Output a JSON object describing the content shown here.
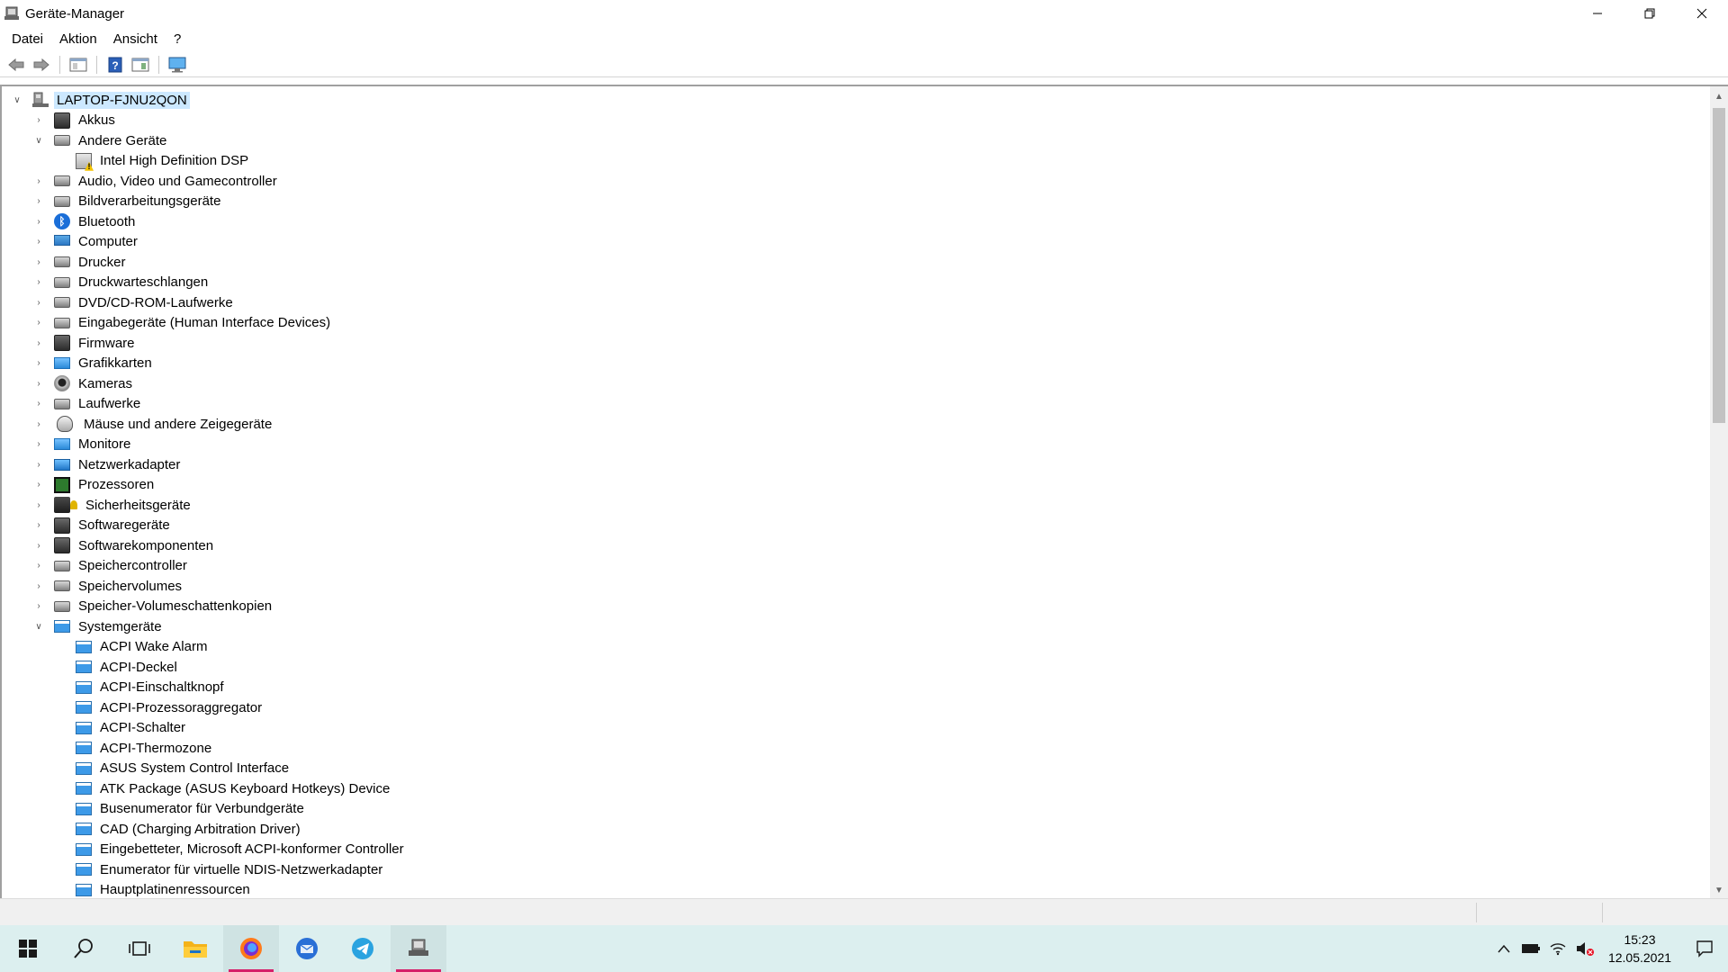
{
  "window": {
    "title": "Geräte-Manager",
    "icon": "device-manager-icon",
    "controls": [
      "minimize-icon",
      "restore-icon",
      "close-icon"
    ]
  },
  "menu": {
    "items": [
      "Datei",
      "Aktion",
      "Ansicht",
      "?"
    ]
  },
  "toolbar": {
    "buttons": [
      "back-arrow-icon",
      "forward-arrow-icon",
      "properties-icon",
      "help-icon",
      "show-hidden-icon",
      "monitor-icon"
    ]
  },
  "tree": {
    "root": "LAPTOP-FJNU2QON",
    "nodes": [
      {
        "label": "Akkus",
        "expanded": false,
        "icon": "battery-icon"
      },
      {
        "label": "Andere Geräte",
        "expanded": true,
        "icon": "unknown-device-icon"
      },
      {
        "label": "Intel High Definition DSP",
        "child": true,
        "icon": "warning-device-icon"
      },
      {
        "label": "Audio, Video und Gamecontroller",
        "expanded": false,
        "icon": "speaker-icon"
      },
      {
        "label": "Bildverarbeitungsgeräte",
        "expanded": false,
        "icon": "scanner-icon"
      },
      {
        "label": "Bluetooth",
        "expanded": false,
        "icon": "bluetooth-icon"
      },
      {
        "label": "Computer",
        "expanded": false,
        "icon": "computer-icon"
      },
      {
        "label": "Drucker",
        "expanded": false,
        "icon": "printer-icon"
      },
      {
        "label": "Druckwarteschlangen",
        "expanded": false,
        "icon": "print-queue-icon"
      },
      {
        "label": "DVD/CD-ROM-Laufwerke",
        "expanded": false,
        "icon": "dvd-drive-icon"
      },
      {
        "label": "Eingabegeräte (Human Interface Devices)",
        "expanded": false,
        "icon": "hid-icon"
      },
      {
        "label": "Firmware",
        "expanded": false,
        "icon": "firmware-icon"
      },
      {
        "label": "Grafikkarten",
        "expanded": false,
        "icon": "display-adapter-icon"
      },
      {
        "label": "Kameras",
        "expanded": false,
        "icon": "camera-icon"
      },
      {
        "label": "Laufwerke",
        "expanded": false,
        "icon": "disk-drive-icon"
      },
      {
        "label": "Mäuse und andere Zeigegeräte",
        "expanded": false,
        "icon": "mouse-icon"
      },
      {
        "label": "Monitore",
        "expanded": false,
        "icon": "monitor-icon"
      },
      {
        "label": "Netzwerkadapter",
        "expanded": false,
        "icon": "network-adapter-icon"
      },
      {
        "label": "Prozessoren",
        "expanded": false,
        "icon": "processor-icon"
      },
      {
        "label": "Sicherheitsgeräte",
        "expanded": false,
        "icon": "security-device-icon"
      },
      {
        "label": "Softwaregeräte",
        "expanded": false,
        "icon": "software-device-icon"
      },
      {
        "label": "Softwarekomponenten",
        "expanded": false,
        "icon": "software-component-icon"
      },
      {
        "label": "Speichercontroller",
        "expanded": false,
        "icon": "storage-controller-icon"
      },
      {
        "label": "Speichervolumes",
        "expanded": false,
        "icon": "storage-volume-icon"
      },
      {
        "label": "Speicher-Volumeschattenkopien",
        "expanded": false,
        "icon": "shadow-copy-icon"
      },
      {
        "label": "Systemgeräte",
        "expanded": true,
        "icon": "system-devices-icon"
      },
      {
        "label": "ACPI Wake Alarm",
        "child": true,
        "icon": "system-device-icon"
      },
      {
        "label": "ACPI-Deckel",
        "child": true,
        "icon": "system-device-icon"
      },
      {
        "label": "ACPI-Einschaltknopf",
        "child": true,
        "icon": "system-device-icon"
      },
      {
        "label": "ACPI-Prozessoraggregator",
        "child": true,
        "icon": "system-device-icon"
      },
      {
        "label": "ACPI-Schalter",
        "child": true,
        "icon": "system-device-icon"
      },
      {
        "label": "ACPI-Thermozone",
        "child": true,
        "icon": "system-device-icon"
      },
      {
        "label": "ASUS System Control Interface",
        "child": true,
        "icon": "system-device-icon"
      },
      {
        "label": "ATK Package (ASUS Keyboard Hotkeys) Device",
        "child": true,
        "icon": "system-device-icon"
      },
      {
        "label": "Busenumerator für Verbundgeräte",
        "child": true,
        "icon": "system-device-icon"
      },
      {
        "label": "CAD (Charging Arbitration Driver)",
        "child": true,
        "icon": "system-device-icon"
      },
      {
        "label": "Eingebetteter, Microsoft ACPI-konformer Controller",
        "child": true,
        "icon": "system-device-icon"
      },
      {
        "label": "Enumerator für virtuelle NDIS-Netzwerkadapter",
        "child": true,
        "icon": "system-device-icon"
      },
      {
        "label": "Hauptplatinenressourcen",
        "child": true,
        "icon": "system-device-icon"
      }
    ]
  },
  "taskbar": {
    "apps": [
      "windows-start-icon",
      "search-icon",
      "task-view-icon",
      "file-explorer-icon",
      "firefox-icon",
      "thunderbird-icon",
      "telegram-icon",
      "device-manager-icon"
    ],
    "active_app": "device-manager-icon",
    "tray": [
      "chevron-up-icon",
      "battery-icon",
      "wifi-icon",
      "volume-muted-icon"
    ],
    "time": "15:23",
    "date": "12.05.2021",
    "notification": "notification-icon"
  }
}
